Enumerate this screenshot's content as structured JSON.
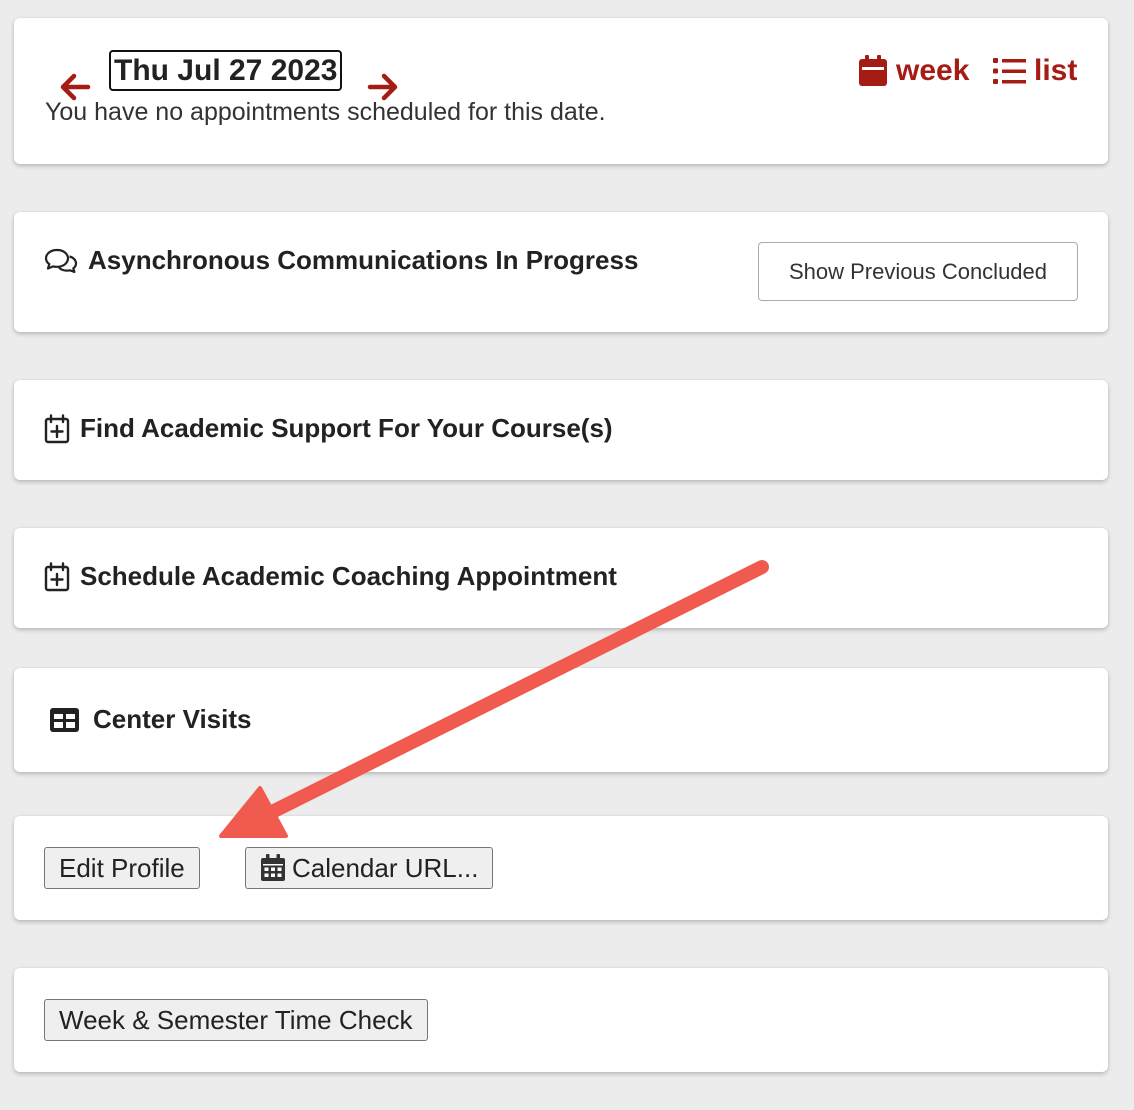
{
  "colors": {
    "accent": "#a51c14",
    "annotation_arrow": "#f05a4f",
    "background": "#ececec"
  },
  "date_nav": {
    "prev_icon": "arrow-left-icon",
    "next_icon": "arrow-right-icon",
    "date": "Thu Jul 27 2023",
    "message": "You have no appointments scheduled for this date.",
    "week_icon": "calendar-icon",
    "week_label": "week",
    "list_icon": "list-icon",
    "list_label": "list"
  },
  "async_comm": {
    "icon": "comments-icon",
    "title": "Asynchronous Communications In Progress",
    "button_label": "Show Previous Concluded"
  },
  "find_support": {
    "icon": "calendar-plus-icon",
    "title": "Find Academic Support For Your Course(s)"
  },
  "coaching": {
    "icon": "calendar-plus-icon",
    "title": "Schedule Academic Coaching Appointment"
  },
  "center_visits": {
    "icon": "table-icon",
    "title": "Center Visits"
  },
  "profile": {
    "edit_label": "Edit Profile",
    "calendar_icon": "calendar-icon",
    "calendar_label": "Calendar URL..."
  },
  "time_check": {
    "label": "Week & Semester Time Check"
  }
}
